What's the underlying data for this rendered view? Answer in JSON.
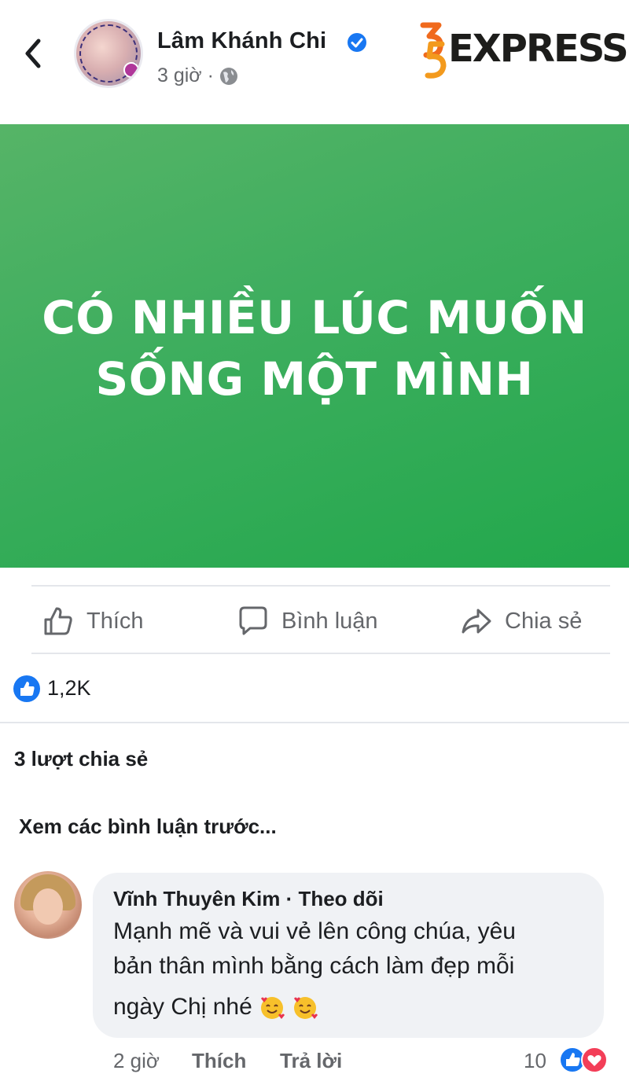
{
  "header": {
    "poster_name": "Lâm Khánh Chi",
    "time": "3 giờ ·",
    "icons": {
      "back": "chevron-left-icon",
      "verified": "verified-badge-icon",
      "privacy": "globe-icon"
    }
  },
  "watermark": {
    "text": "EXPRESS",
    "mark": "35"
  },
  "status_card": {
    "line1": "CÓ NHIỀU LÚC MUỐN",
    "line2": "SỐNG MỘT MÌNH",
    "background": "#3fae5f"
  },
  "actions": {
    "like": "Thích",
    "comment": "Bình luận",
    "share": "Chia sẻ"
  },
  "reactions": {
    "count": "1,2K"
  },
  "shares": {
    "label": "3 lượt chia sẻ"
  },
  "comments": {
    "prev_label": "Xem các bình luận trước...",
    "items": [
      {
        "author": "Vĩnh Thuyên Kim",
        "separator": " · ",
        "follow": "Theo dõi",
        "text_line1": "Mạnh mẽ và vui vẻ lên công chúa, yêu",
        "text_line2": "bản thân mình bằng cách làm đẹp mỗi",
        "text_line3": "ngày Chị nhé",
        "time": "2 giờ",
        "like": "Thích",
        "reply": "Trả lời",
        "reaction_count": "10"
      }
    ]
  },
  "colors": {
    "accent": "#1877f2",
    "text_secondary": "#65676b",
    "bubble": "#f0f2f5",
    "heart": "#f33e58"
  }
}
